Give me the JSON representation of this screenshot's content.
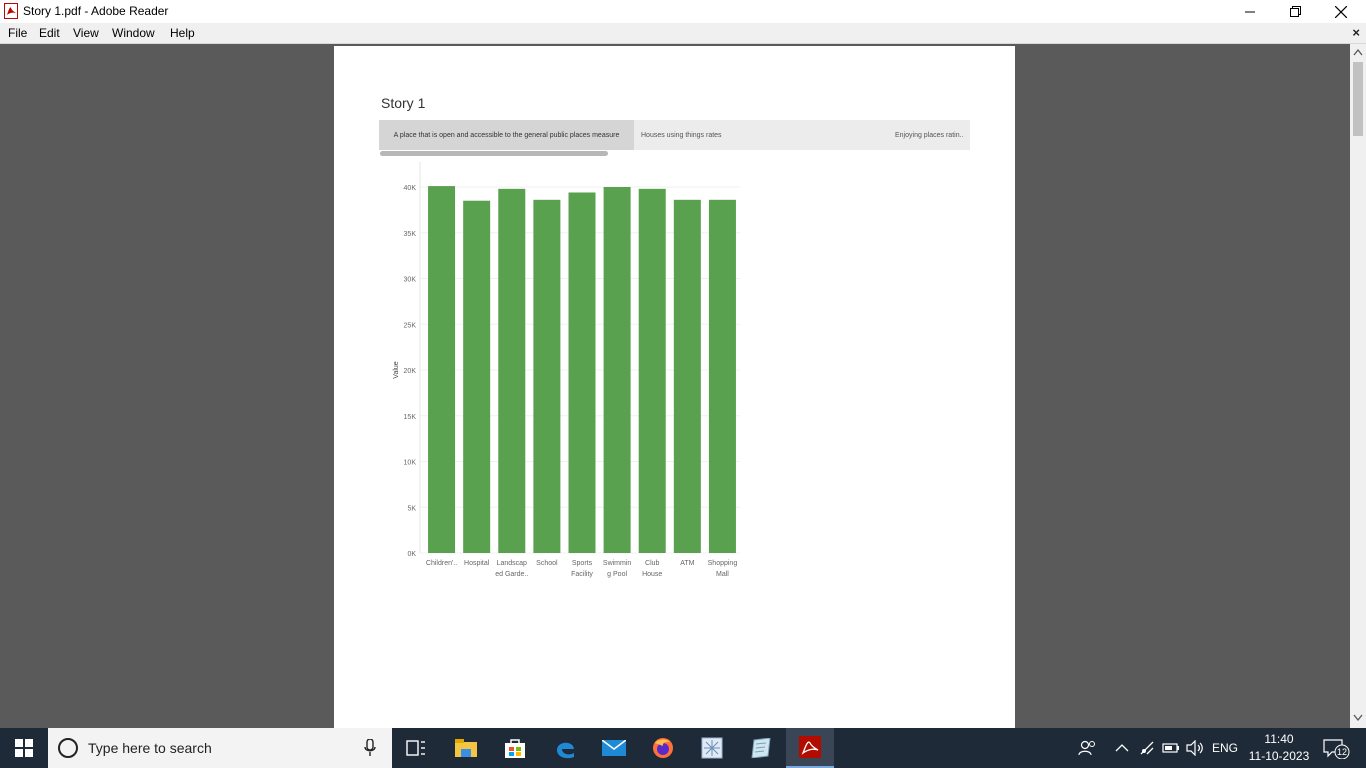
{
  "window": {
    "title": "Story 1.pdf - Adobe Reader",
    "minimize_icon": "minimize-icon",
    "restore_icon": "restore-icon",
    "close_icon": "close-icon"
  },
  "menu": {
    "items": [
      "File",
      "Edit",
      "View",
      "Window",
      "Help"
    ],
    "close_doc": "×"
  },
  "story": {
    "title": "Story 1",
    "points": [
      "A place that is open and accessible to the general public places measure",
      "Houses using things rates",
      "Enjoying places ratin.."
    ]
  },
  "chart_data": {
    "type": "bar",
    "categories": [
      "Children'..",
      "Hospital",
      "Landscaped Garde..",
      "School",
      "Sports Facility",
      "Swimming Pool",
      "Club House",
      "ATM",
      "Shopping Mall"
    ],
    "category_lines": [
      [
        "Children'.."
      ],
      [
        "Hospital"
      ],
      [
        "Landscap",
        "ed Garde.."
      ],
      [
        "School"
      ],
      [
        "Sports",
        "Facility"
      ],
      [
        "Swimmin",
        "g Pool"
      ],
      [
        "Club",
        "House"
      ],
      [
        "ATM"
      ],
      [
        "Shopping",
        "Mall"
      ]
    ],
    "values": [
      40100,
      38500,
      39800,
      38600,
      39400,
      40000,
      39800,
      38600,
      38600
    ],
    "ylabel": "Value",
    "ylim": [
      0,
      40000
    ],
    "yticks": [
      0,
      5000,
      10000,
      15000,
      20000,
      25000,
      30000,
      35000,
      40000
    ],
    "ytick_labels": [
      "0K",
      "5K",
      "10K",
      "15K",
      "20K",
      "25K",
      "30K",
      "35K",
      "40K"
    ],
    "bar_color": "#59a14f",
    "grid": true
  },
  "taskbar": {
    "search_placeholder": "Type here to search",
    "apps": [
      "task-view-icon",
      "file-explorer-icon",
      "store-icon",
      "edge-icon",
      "mail-icon",
      "firefox-icon",
      "snipping-icon",
      "notepad-icon",
      "adobe-reader-icon"
    ],
    "lang": "ENG",
    "time": "11:40",
    "date": "11-10-2023",
    "notifications": "12"
  }
}
